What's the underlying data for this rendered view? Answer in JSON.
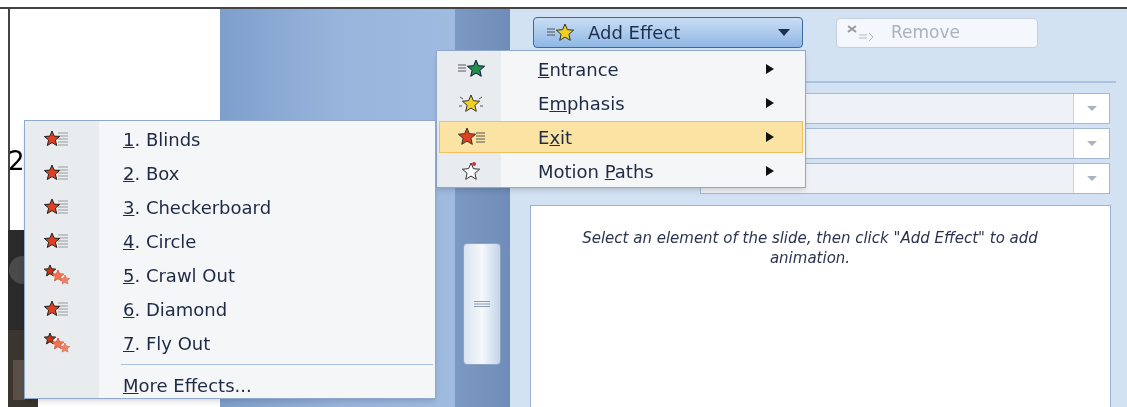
{
  "slide": {
    "text": "2"
  },
  "add_effect_button": {
    "label": "Add Effect"
  },
  "remove_button": {
    "label": "Remove",
    "disabled": true
  },
  "hint": "Select an element of the slide, then click \"Add Effect\" to add animation.",
  "effect_menu": [
    {
      "access_key": "E",
      "rest": "ntrance",
      "kind": "entrance",
      "selected": false
    },
    {
      "prefix": "E",
      "access_key": "m",
      "rest": "phasis",
      "kind": "emphasis",
      "selected": false
    },
    {
      "prefix": "E",
      "access_key": "x",
      "rest": "it",
      "kind": "exit",
      "selected": true
    },
    {
      "prefix": "Motion ",
      "access_key": "P",
      "rest": "aths",
      "kind": "motion",
      "selected": false
    }
  ],
  "exit_menu": [
    {
      "access_key": "1",
      "rest": ". Blinds",
      "kind": "blinds"
    },
    {
      "access_key": "2",
      "rest": ". Box",
      "kind": "blinds"
    },
    {
      "access_key": "3",
      "rest": ". Checkerboard",
      "kind": "blinds"
    },
    {
      "access_key": "4",
      "rest": ". Circle",
      "kind": "blinds"
    },
    {
      "access_key": "5",
      "rest": ". Crawl Out",
      "kind": "fly"
    },
    {
      "access_key": "6",
      "rest": ". Diamond",
      "kind": "blinds"
    },
    {
      "access_key": "7",
      "rest": ". Fly Out",
      "kind": "fly"
    },
    {
      "access_key": "M",
      "rest": "ore Effects...",
      "kind": "more"
    }
  ]
}
